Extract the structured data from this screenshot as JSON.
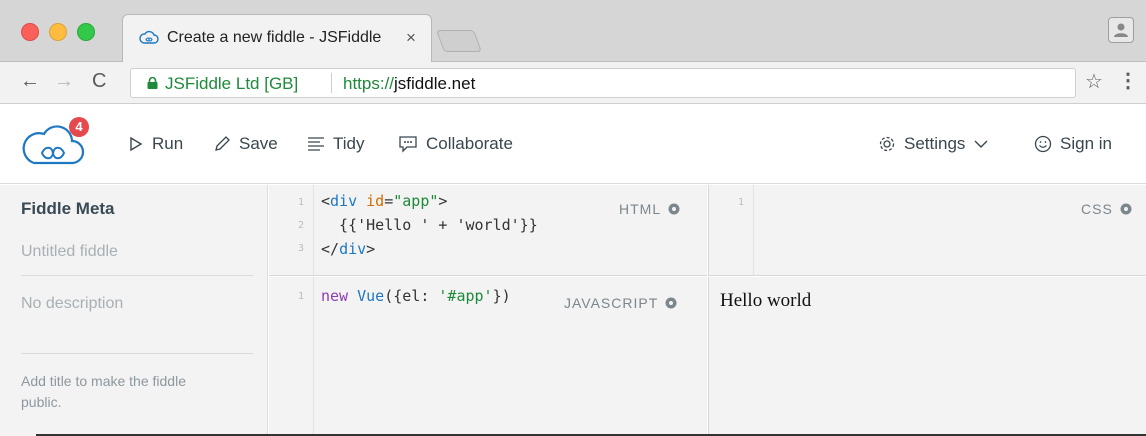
{
  "browser": {
    "tab_title": "Create a new fiddle - JSFiddle",
    "tab_close": "×",
    "site_identity": "JSFiddle Ltd [GB]",
    "url_scheme": "https://",
    "url_host": "jsfiddle.net"
  },
  "toolbar": {
    "badge_count": "4",
    "run_label": "Run",
    "save_label": "Save",
    "tidy_label": "Tidy",
    "collaborate_label": "Collaborate",
    "settings_label": "Settings",
    "signin_label": "Sign in"
  },
  "sidebar": {
    "title": "Fiddle Meta",
    "name_placeholder": "Untitled fiddle",
    "description_placeholder": "No description",
    "hint": "Add title to make the fiddle public."
  },
  "panels": {
    "html_label": "HTML",
    "css_label": "CSS",
    "js_label": "JAVASCRIPT",
    "html_lines": [
      "1",
      "2",
      "3"
    ],
    "css_lines": [
      "1"
    ],
    "js_lines": [
      "1"
    ]
  },
  "code": {
    "html_line1_open": "<",
    "html_line1_tag": "div",
    "html_line1_attr": " id",
    "html_line1_eq": "=",
    "html_line1_val": "\"app\"",
    "html_line1_close": ">",
    "html_line2": "  {{'Hello ' + 'world'}}",
    "html_line3_open": "</",
    "html_line3_tag": "div",
    "html_line3_close": ">",
    "js_kw": "new",
    "js_cls": " Vue",
    "js_rest1": "({el: ",
    "js_str": "'#app'",
    "js_rest2": "})"
  },
  "result": {
    "text": "Hello world"
  },
  "colors": {
    "accent_blue": "#1d78c1",
    "badge_red": "#e5484d",
    "secure_green": "#1e8a3a"
  }
}
